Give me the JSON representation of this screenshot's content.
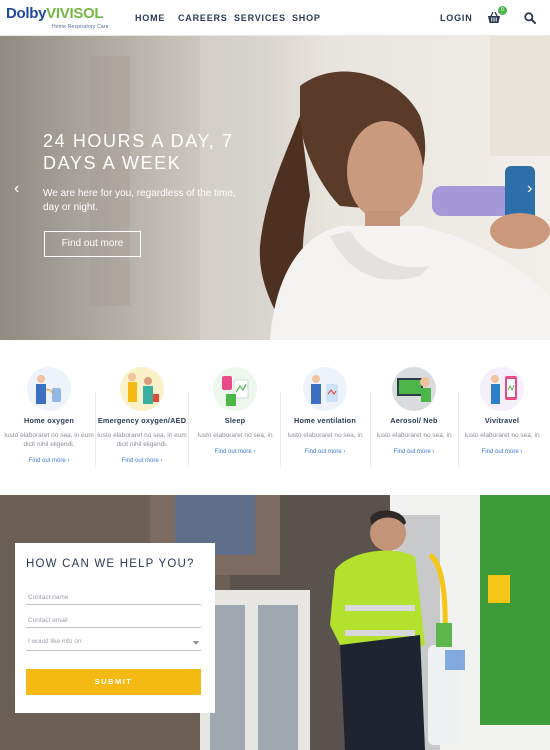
{
  "header": {
    "logo_part1": "Dolby",
    "logo_part2": "VIVISOL",
    "logo_tagline": "Home Respiratory Care",
    "nav": [
      "HOME",
      "CAREERS",
      "SERVICES",
      "SHOP"
    ],
    "login": "LOGIN",
    "cart_count": "0",
    "icons": {
      "cart": "basket-icon",
      "search": "search-icon"
    }
  },
  "hero": {
    "title": "24 HOURS A DAY, 7 DAYS A WEEK",
    "subtitle": "We are here for you, regardless of the time, day or night.",
    "button": "Find out more"
  },
  "services": [
    {
      "title": "Home oxygen",
      "desc": "Iusto elaboraret no sea, in eum dicit nihil eligendi.",
      "link": "Find out more ›"
    },
    {
      "title": "Emergency oxygen/AED",
      "desc": "Iusto elaboraret no sea, in eum dicit nihil eligendi.",
      "link": "Find out more ›"
    },
    {
      "title": "Sleep",
      "desc": "Iusto elaboraret no sea, in",
      "link": "Find out more ›"
    },
    {
      "title": "Home ventilation",
      "desc": "Iusto elaboraret no sea, in",
      "link": "Find out more ›"
    },
    {
      "title": "Aerosol/ Neb",
      "desc": "Iusto elaboraret no sea, in",
      "link": "Find out more ›"
    },
    {
      "title": "Vivitravel",
      "desc": "Iusto elaboraret no sea, in",
      "link": "Find out more ›"
    }
  ],
  "form": {
    "title": "HOW CAN WE HELP YOU?",
    "name_placeholder": "Contact name",
    "email_placeholder": "Contact email",
    "select_value": "I would like info on",
    "submit": "SUBMIT"
  },
  "colors": {
    "brand_blue": "#1f4aa0",
    "brand_green": "#73b843",
    "accent_yellow": "#f5b914",
    "link_blue": "#3a7bd5"
  }
}
